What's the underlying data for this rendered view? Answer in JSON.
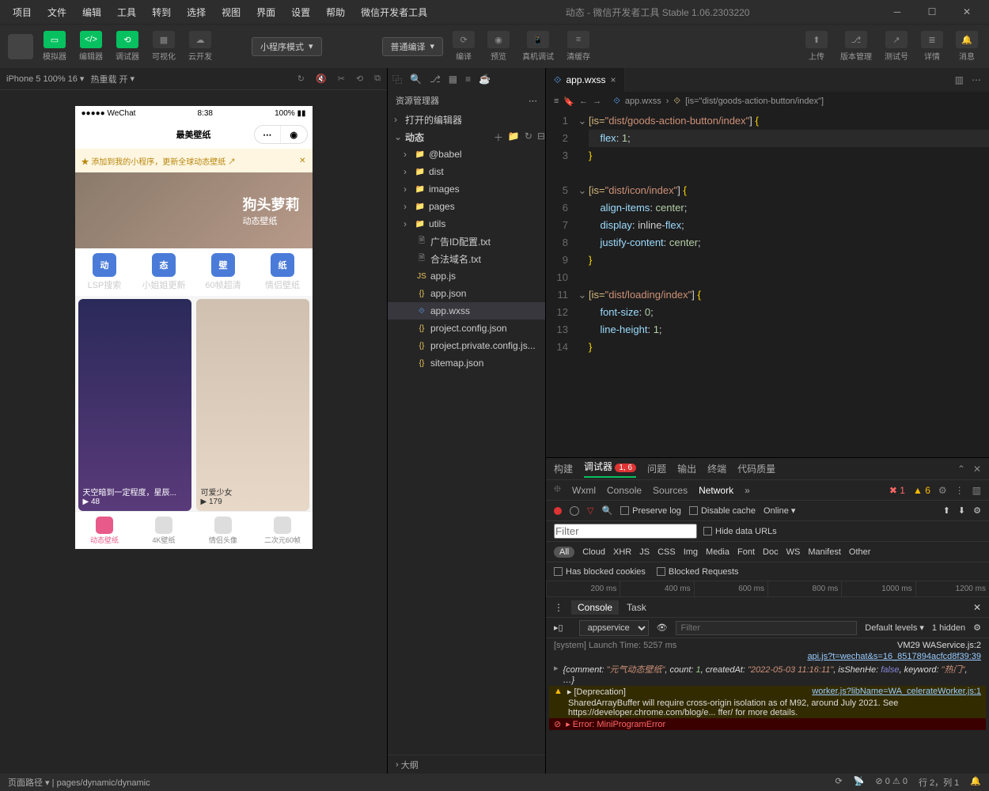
{
  "titlebar": {
    "menus": [
      "项目",
      "文件",
      "编辑",
      "工具",
      "转到",
      "选择",
      "视图",
      "界面",
      "设置",
      "帮助",
      "微信开发者工具"
    ],
    "title": "动态 - 微信开发者工具 Stable 1.06.2303220"
  },
  "toolbar": {
    "buttons": [
      {
        "label": "模拟器",
        "green": true
      },
      {
        "label": "编辑器",
        "green": true
      },
      {
        "label": "调试器",
        "green": true
      },
      {
        "label": "可视化",
        "green": false
      },
      {
        "label": "云开发",
        "green": false
      }
    ],
    "mode_select": "小程序模式",
    "compile_select": "普通编译",
    "compile": "编译",
    "preview": "预览",
    "real": "真机调试",
    "cache": "清缓存",
    "right": [
      {
        "label": "上传"
      },
      {
        "label": "版本管理"
      },
      {
        "label": "测试号"
      },
      {
        "label": "详情"
      },
      {
        "label": "消息"
      }
    ]
  },
  "simulator": {
    "device": "iPhone 5 100% 16",
    "hot_reload": "热重载 开",
    "status_left": "●●●●● WeChat",
    "time": "8:38",
    "battery": "100%",
    "nav_title": "最美壁纸",
    "banner": "添加到我的小程序，更新全球动态壁纸",
    "hero_title": "狗头萝莉",
    "hero_sub": "动态壁纸",
    "cats": [
      {
        "badge": "动",
        "label": "LSP搜索"
      },
      {
        "badge": "态",
        "label": "小姐姐更新"
      },
      {
        "badge": "壁",
        "label": "60帧超清"
      },
      {
        "badge": "纸",
        "label": "情侣壁纸"
      }
    ],
    "card1": {
      "title": "天空暗到一定程度，星辰...",
      "plays": "48"
    },
    "card2": {
      "title": "可爱少女",
      "plays": "179"
    },
    "tabs": [
      {
        "label": "动态壁纸",
        "active": true
      },
      {
        "label": "4K壁纸"
      },
      {
        "label": "情侣头像"
      },
      {
        "label": "二次元60帧"
      }
    ]
  },
  "explorer": {
    "title": "资源管理器",
    "sections": {
      "open_editors": "打开的编辑器",
      "project": "动态",
      "outline": "大纲"
    },
    "tree": [
      {
        "name": "@babel",
        "type": "folder"
      },
      {
        "name": "dist",
        "type": "folder"
      },
      {
        "name": "images",
        "type": "folder"
      },
      {
        "name": "pages",
        "type": "folder"
      },
      {
        "name": "utils",
        "type": "folder"
      },
      {
        "name": "广告ID配置.txt",
        "type": "txt"
      },
      {
        "name": "合法域名.txt",
        "type": "txt"
      },
      {
        "name": "app.js",
        "type": "js"
      },
      {
        "name": "app.json",
        "type": "json"
      },
      {
        "name": "app.wxss",
        "type": "wxss",
        "selected": true
      },
      {
        "name": "project.config.json",
        "type": "json"
      },
      {
        "name": "project.private.config.js...",
        "type": "json"
      },
      {
        "name": "sitemap.json",
        "type": "json"
      }
    ]
  },
  "editor": {
    "tab": "app.wxss",
    "breadcrumb": [
      "app.wxss",
      "[is=\"dist/goods-action-button/index\"]"
    ],
    "lines": [
      "[is=\"dist/goods-action-button/index\"] {",
      "    flex: 1;",
      "}",
      "",
      "[is=\"dist/icon/index\"] {",
      "    align-items: center;",
      "    display: inline-flex;",
      "    justify-content: center;",
      "}",
      "",
      "[is=\"dist/loading/index\"] {",
      "    font-size: 0;",
      "    line-height: 1;",
      "}"
    ]
  },
  "devtools": {
    "tabs": [
      "构建",
      "调试器",
      "问题",
      "输出",
      "终端",
      "代码质量"
    ],
    "debugger_badge": "1, 6",
    "subtabs": [
      "Wxml",
      "Console",
      "Sources",
      "Network"
    ],
    "err_count": "1",
    "warn_count": "6",
    "preserve": "Preserve log",
    "disable_cache": "Disable cache",
    "online": "Online",
    "filter": "Filter",
    "hide_urls": "Hide data URLs",
    "types": [
      "All",
      "Cloud",
      "XHR",
      "JS",
      "CSS",
      "Img",
      "Media",
      "Font",
      "Doc",
      "WS",
      "Manifest",
      "Other"
    ],
    "blocked_cookies": "Has blocked cookies",
    "blocked_req": "Blocked Requests",
    "timeline": [
      "200 ms",
      "400 ms",
      "600 ms",
      "800 ms",
      "1000 ms",
      "1200 ms"
    ],
    "console_tabs": [
      "Console",
      "Task"
    ],
    "context": "appservice",
    "levels": "Default levels",
    "hidden": "1 hidden",
    "log_lines": [
      {
        "t": "info",
        "text": "[system] Launch Time: 5257 ms",
        "right": "VM29 WAService.js:2"
      },
      {
        "t": "link",
        "right": "api.js?t=wechat&s=16_8517894acfcd8f39:39"
      },
      {
        "t": "obj",
        "text": "{comment: \"元气动态壁纸\", count: 1, createdAt: \"2022-05-03 11:16:11\", isShenHe: false, keyword: \"热门\", …}"
      },
      {
        "t": "warn",
        "text": "[Deprecation]",
        "right": "worker.js?libName=WA_celerateWorker.js:1"
      },
      {
        "t": "warn-body",
        "text": "SharedArrayBuffer will require cross-origin isolation as of M92, around July 2021. See https://developer.chrome.com/blog/e... ffer/ for more details."
      },
      {
        "t": "err",
        "text": "Error: MiniProgramError"
      }
    ]
  },
  "statusbar": {
    "path_label": "页面路径",
    "path": "pages/dynamic/dynamic",
    "errors": "0",
    "warnings": "0",
    "cursor": "行 2，列 1"
  }
}
